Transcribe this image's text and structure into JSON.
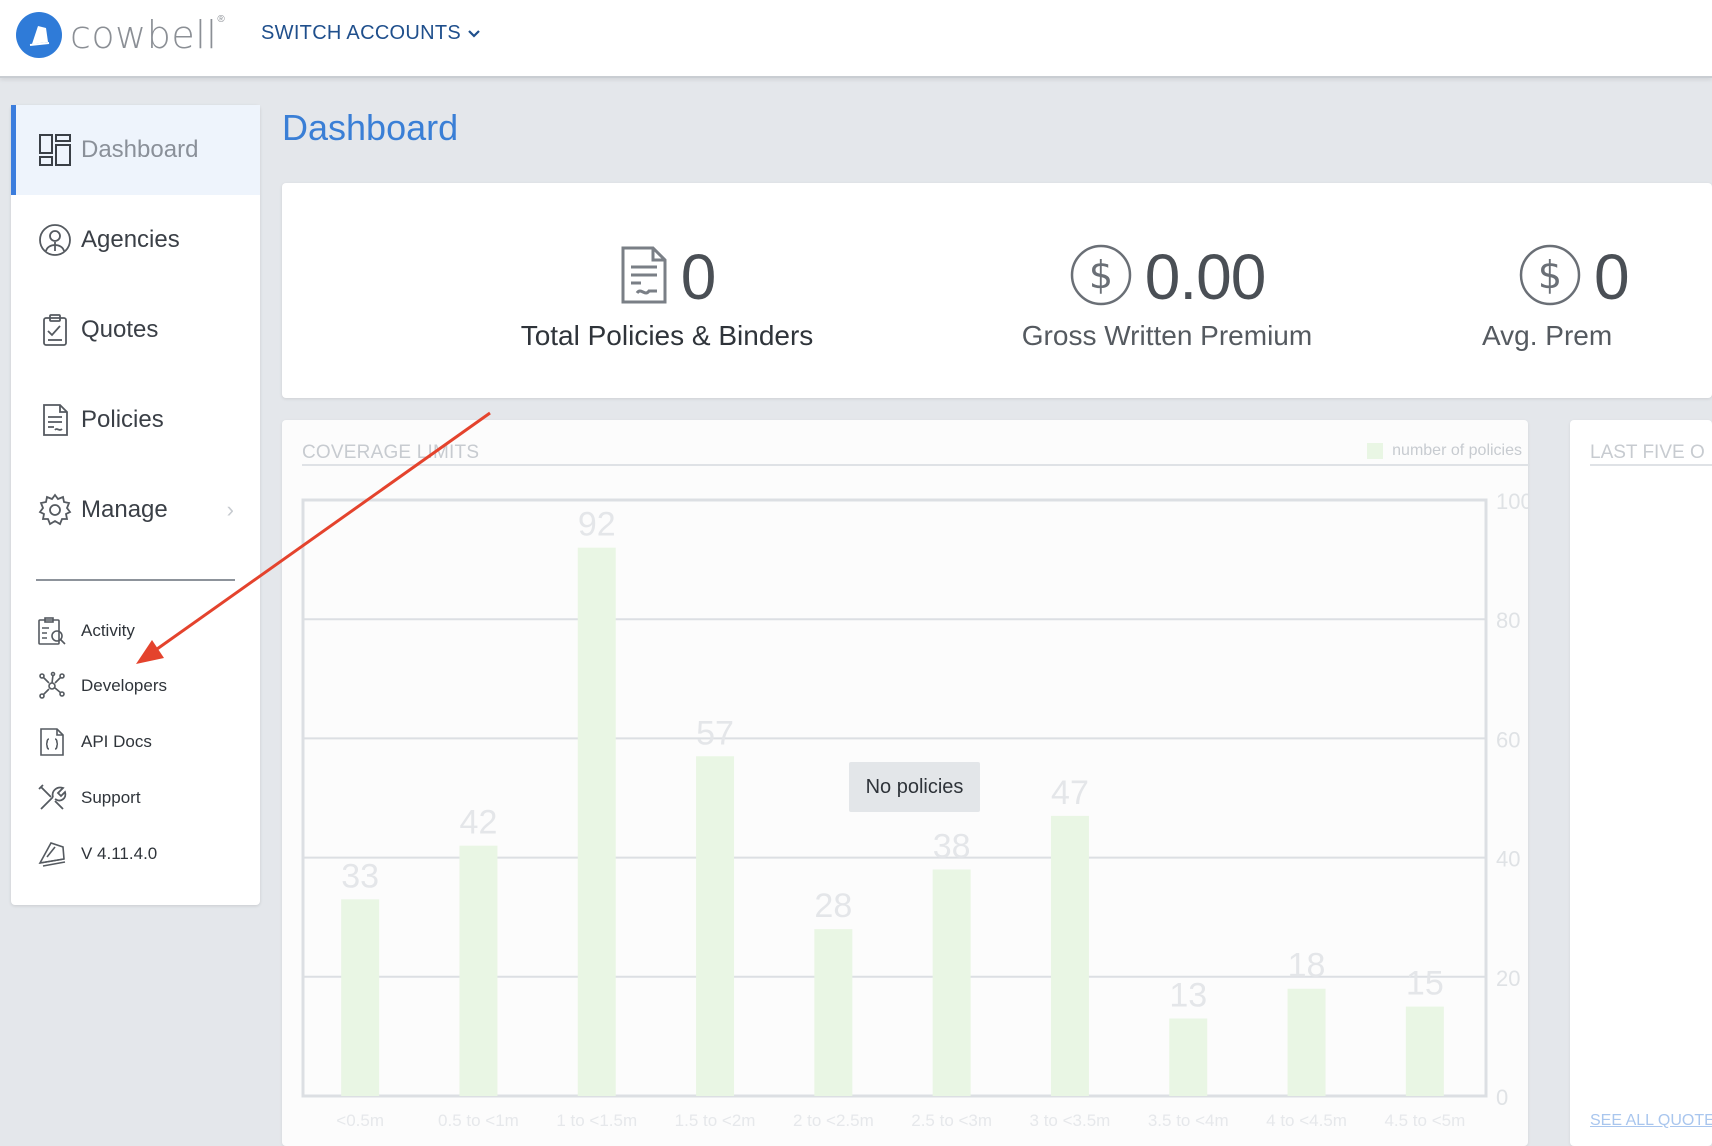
{
  "header": {
    "logo_text": "cowbell",
    "logo_mark": "®",
    "switch_accounts": "SWITCH ACCOUNTS"
  },
  "sidebar": {
    "items": [
      {
        "label": "Dashboard",
        "icon": "dashboard-icon",
        "active": true
      },
      {
        "label": "Agencies",
        "icon": "agencies-icon"
      },
      {
        "label": "Quotes",
        "icon": "quotes-icon"
      },
      {
        "label": "Policies",
        "icon": "policies-icon"
      },
      {
        "label": "Manage",
        "icon": "gear-icon",
        "has_submenu": true
      }
    ],
    "secondary": [
      {
        "label": "Activity",
        "icon": "activity-icon"
      },
      {
        "label": "Developers",
        "icon": "developers-icon"
      },
      {
        "label": "API Docs",
        "icon": "api-docs-icon"
      },
      {
        "label": "Support",
        "icon": "support-icon"
      },
      {
        "label": "V 4.11.4.0",
        "icon": "version-icon"
      }
    ]
  },
  "main": {
    "title": "Dashboard",
    "stats": [
      {
        "value": "0",
        "label": "Total Policies & Binders",
        "icon": "document-icon"
      },
      {
        "value": "0.00",
        "label": "Gross Written Premium",
        "icon": "dollar-icon"
      },
      {
        "value": "0",
        "label": "Avg. Prem",
        "icon": "dollar-icon"
      }
    ],
    "coverage_card": {
      "title": "COVERAGE LIMITS",
      "legend": "number of policies",
      "empty_message": "No policies"
    },
    "last_five_card": {
      "title": "LAST FIVE O",
      "see_all": "SEE ALL QUOTE"
    }
  },
  "colors": {
    "accent": "#3b7ddd",
    "bar": "#e9f6e4",
    "arrow": "#e4432d"
  },
  "chart_data": {
    "type": "bar",
    "title": "COVERAGE LIMITS",
    "categories": [
      "<0.5m",
      "0.5 to <1m",
      "1 to <1.5m",
      "1.5 to <2m",
      "2 to <2.5m",
      "2.5 to <3m",
      "3 to <3.5m",
      "3.5 to <4m",
      "4 to <4.5m",
      "4.5 to <5m"
    ],
    "series": [
      {
        "name": "number of policies",
        "values": [
          33,
          42,
          92,
          57,
          28,
          38,
          47,
          13,
          18,
          15
        ]
      }
    ],
    "ylim": [
      0,
      100
    ],
    "yticks": [
      0,
      20,
      40,
      60,
      80,
      100
    ],
    "legend_position": "top-right",
    "grid": true
  }
}
